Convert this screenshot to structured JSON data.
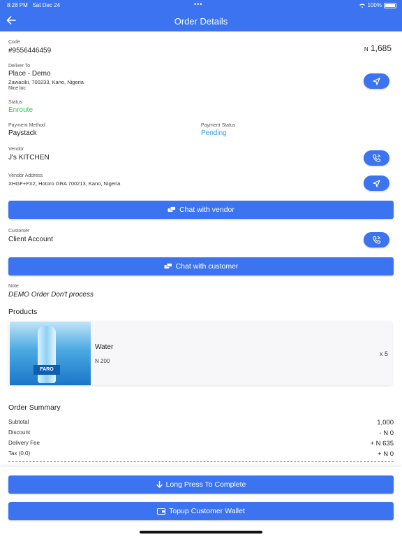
{
  "status_bar": {
    "time": "8:28 PM",
    "date": "Sat Dec 24",
    "battery": "100%"
  },
  "header": {
    "title": "Order Details"
  },
  "order": {
    "code_label": "Code",
    "code": "#9556446459",
    "total_currency": "N",
    "total": "1,685",
    "deliver_to_label": "Deliver To",
    "place_name": "Place - Demo",
    "address": "Zawaciki, 700233, Kano, Nigeria",
    "address_note": "Nice loc",
    "status_label": "Status",
    "status": "Enroute",
    "payment_method_label": "Payment Method",
    "payment_method": "Paystack",
    "payment_status_label": "Payment Status",
    "payment_status": "Pending",
    "vendor_label": "Vendor",
    "vendor": "J's KITCHEN",
    "vendor_address_label": "Vendor Address",
    "vendor_address": "XHGF+FX2, Hotoro GRA 700213, Kano, Nigeria",
    "customer_label": "Customer",
    "customer": "Client Account",
    "note_label": "Note",
    "note": "DEMO Order Don't process"
  },
  "buttons": {
    "chat_vendor": "Chat with vendor",
    "chat_customer": "Chat with customer",
    "complete": "Long Press To Complete",
    "topup": "Topup Customer Wallet"
  },
  "products": {
    "heading": "Products",
    "items": [
      {
        "name": "Water",
        "price": "N 200",
        "qty": "x 5",
        "image_text": "FARO"
      }
    ]
  },
  "summary": {
    "heading": "Order Summary",
    "rows": [
      {
        "label": "Subtotal",
        "value": "1,000"
      },
      {
        "label": "Discount",
        "value": "- N 0"
      },
      {
        "label": "Delivery Fee",
        "value": "+ N 635"
      },
      {
        "label": "Tax (0.0)",
        "value": "+ N 0"
      }
    ]
  },
  "colors": {
    "primary": "#3b73f0",
    "status_green": "#2ecc40",
    "pending_blue": "#3a9be0"
  }
}
